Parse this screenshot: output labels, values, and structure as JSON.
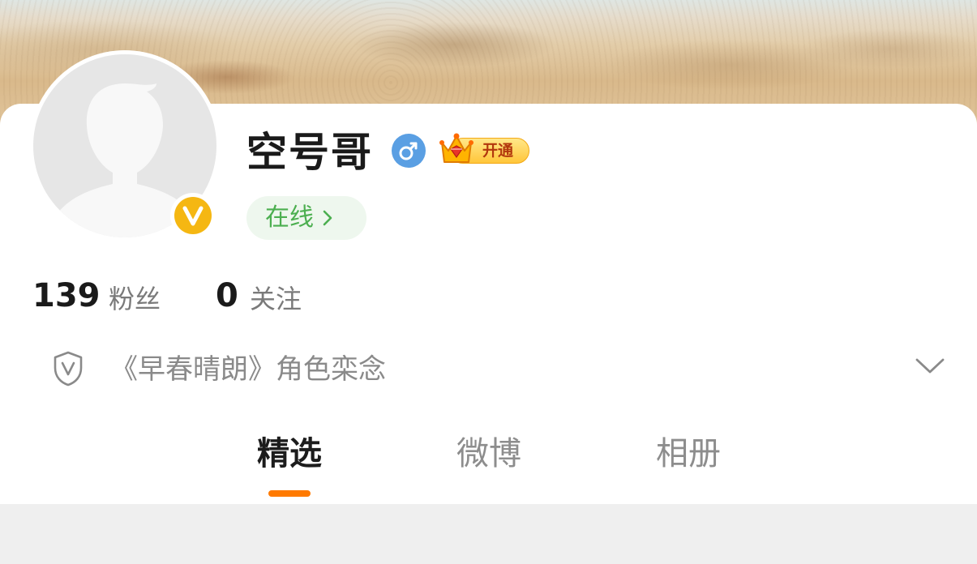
{
  "profile": {
    "name": "空号哥",
    "gender_icon": "male-icon",
    "vip_badge_label": "开通",
    "status_label": "在线",
    "verified_badge_letter": "V",
    "fans_count": "139",
    "fans_label": "粉丝",
    "following_count": "0",
    "following_label": "关注",
    "bio": "《早春晴朗》角色栾念"
  },
  "tabs": [
    {
      "label": "精选",
      "active": true
    },
    {
      "label": "微博",
      "active": false
    },
    {
      "label": "相册",
      "active": false
    }
  ],
  "colors": {
    "accent_orange": "#ff7a00",
    "online_green": "#4caf50",
    "gender_blue": "#5a9fe3",
    "verify_gold": "#f5b712"
  }
}
